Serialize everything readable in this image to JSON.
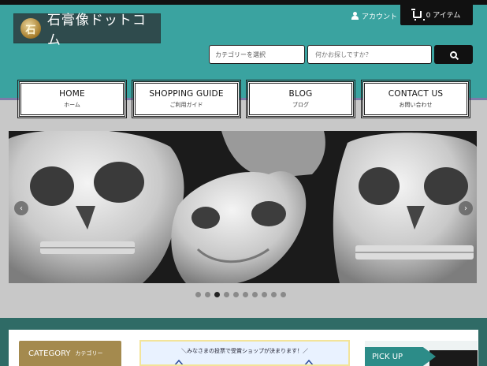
{
  "site": {
    "logo_glyph": "石",
    "logo_text": "石膏像ドットコム"
  },
  "header": {
    "account_label": "アカウント",
    "cart_label": "0 アイテム",
    "category_select_label": "カテゴリーを選択",
    "search_placeholder": "何かお探しですか？"
  },
  "nav": [
    {
      "label": "HOME",
      "sub": "ホーム"
    },
    {
      "label": "SHOPPING GUIDE",
      "sub": "ご利用ガイド"
    },
    {
      "label": "BLOG",
      "sub": "ブログ"
    },
    {
      "label": "CONTACT US",
      "sub": "お問い合わせ"
    }
  ],
  "slider": {
    "prev_glyph": "‹",
    "next_glyph": "›",
    "dot_count": 10,
    "active_dot": 2
  },
  "sections": {
    "category_label": "CATEGORY",
    "category_sub": "カテゴリー",
    "banner_text": "＼みなさまの投票で受賞ショップが決まります！／",
    "pickup_label": "PICK UP"
  },
  "colors": {
    "header_teal": "#3aa3a0",
    "logo_bg": "#2f4b4d",
    "category_gold": "#a48a4e",
    "pickup_teal": "#2c8c88"
  }
}
